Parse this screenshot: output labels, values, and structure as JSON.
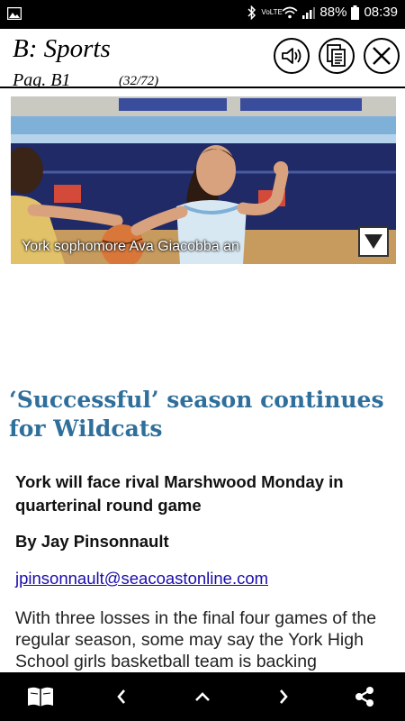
{
  "status_bar": {
    "volte_label": "VoLTE",
    "battery": "88%",
    "time": "08:39"
  },
  "header": {
    "section": "B: Sports",
    "page": "Pag. B1",
    "page_count": "(32/72)"
  },
  "photo": {
    "caption": "York sophomore Ava Giacobba an"
  },
  "article": {
    "headline": "‘Successful’ season continues for Wildcats",
    "subhead": "York will face rival Marshwood Monday in quarterinal round game",
    "byline": "By Jay Pinsonnault",
    "email": "jpinsonnault@seacoastonline.com",
    "body": "With three losses in the final four games of the regular season, some may say the York High School girls basketball team is backing"
  },
  "icons": {
    "gallery": "image-icon",
    "bluetooth": "bluetooth-icon",
    "wifi": "wifi-icon",
    "signal": "signal-icon",
    "battery": "battery-icon",
    "audio": "speaker-icon",
    "text_mode": "text-document-icon",
    "close": "close-icon",
    "caption_toggle": "triangle-down-icon",
    "book": "book-icon",
    "back": "chevron-left-icon",
    "up": "chevron-up-icon",
    "forward": "chevron-right-icon",
    "share": "share-icon"
  }
}
